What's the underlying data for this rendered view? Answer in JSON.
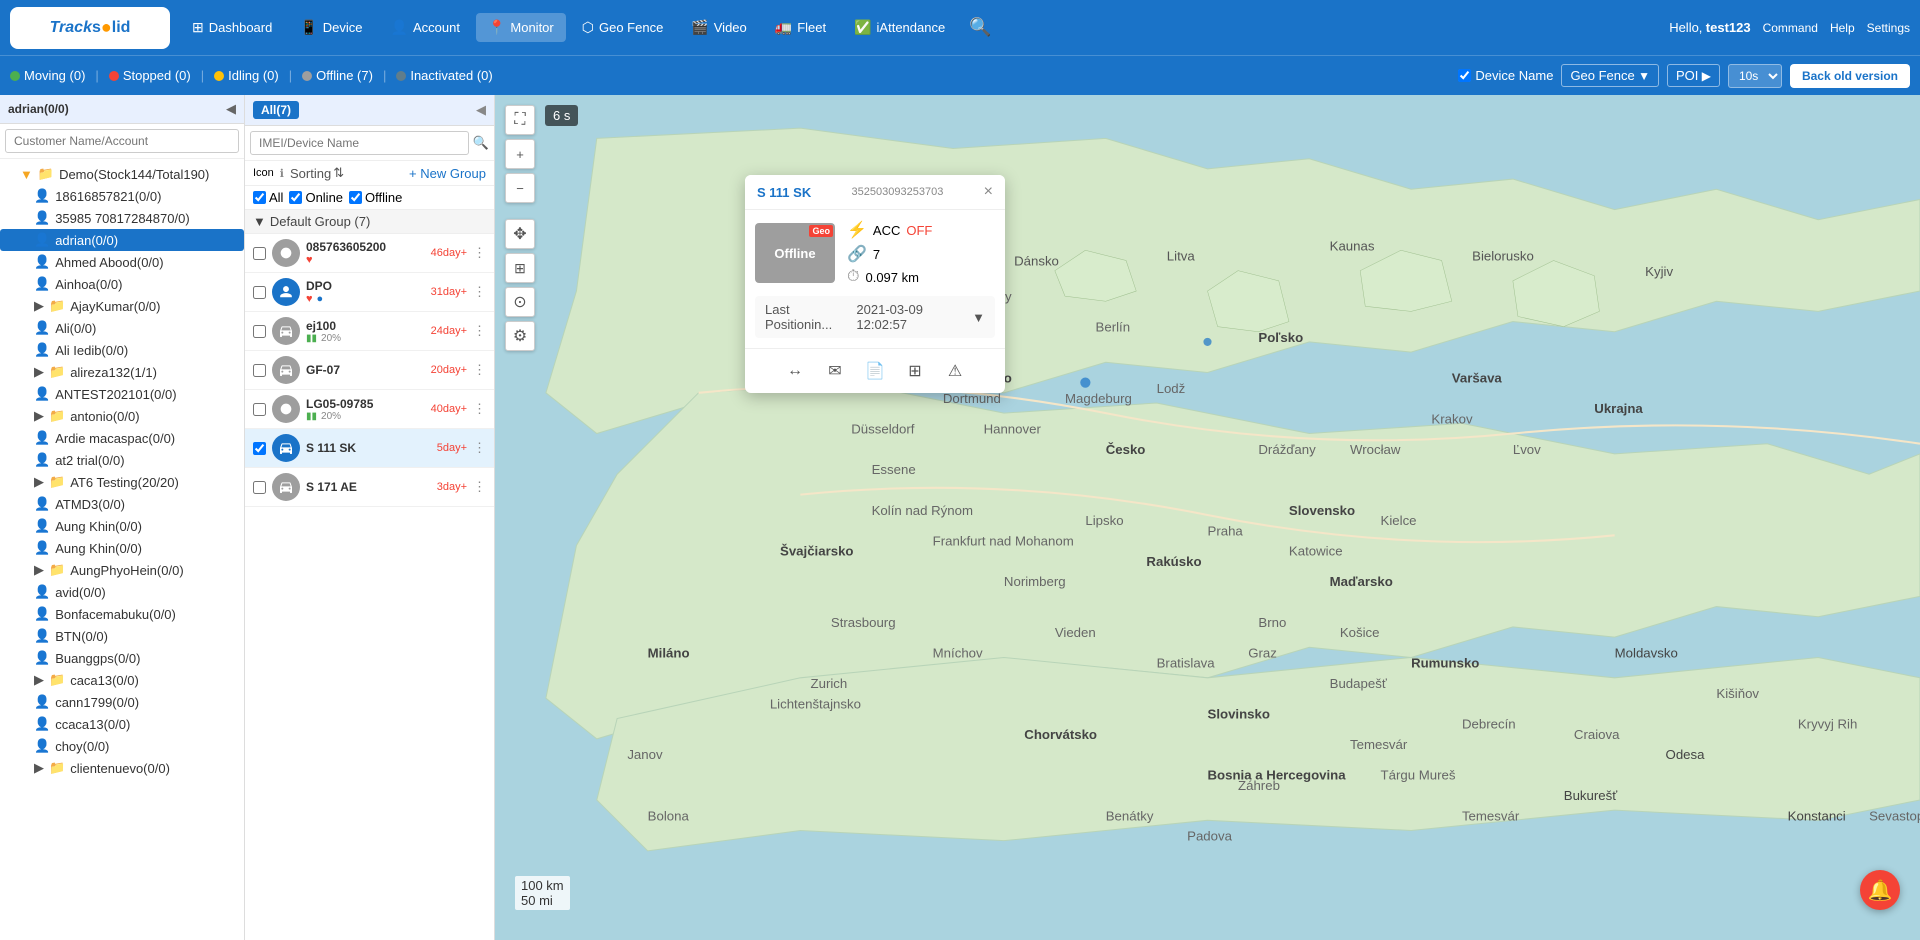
{
  "app": {
    "logo": "Track solid",
    "logo_dot": "·"
  },
  "nav": {
    "items": [
      {
        "id": "dashboard",
        "icon": "⊞",
        "label": "Dashboard"
      },
      {
        "id": "device",
        "icon": "📱",
        "label": "Device"
      },
      {
        "id": "account",
        "icon": "👤",
        "label": "Account"
      },
      {
        "id": "monitor",
        "icon": "📍",
        "label": "Monitor"
      },
      {
        "id": "geofence",
        "icon": "⬡",
        "label": "Geo Fence"
      },
      {
        "id": "video",
        "icon": "🎬",
        "label": "Video"
      },
      {
        "id": "fleet",
        "icon": "🚛",
        "label": "Fleet"
      },
      {
        "id": "iattendance",
        "icon": "✅",
        "label": "iAttendance"
      }
    ],
    "hello": "Hello,",
    "username": "test123",
    "command": "Command",
    "help": "Help",
    "settings": "Settings"
  },
  "statusbar": {
    "moving": "Moving (0)",
    "stopped": "Stopped (0)",
    "idling": "Idling (0)",
    "offline": "Offline (7)",
    "inactivated": "Inactivated (0)",
    "device_name_label": "Device Name",
    "geo_fence_label": "Geo Fence",
    "poi_label": "POI",
    "interval": "10s",
    "back_old_version": "Back old version"
  },
  "sidebar": {
    "header": "adrian(0/0)",
    "search_placeholder": "Customer Name/Account",
    "items": [
      {
        "id": "demo",
        "label": "Demo(Stock144/Total190)",
        "level": 1,
        "type": "group",
        "expanded": true
      },
      {
        "id": "acc1",
        "label": "18616857821(0/0)",
        "level": 2,
        "type": "person"
      },
      {
        "id": "acc2",
        "label": "35985 70817284870/0)",
        "level": 2,
        "type": "person"
      },
      {
        "id": "adrian",
        "label": "adrian(0/0)",
        "level": 2,
        "type": "person",
        "selected": true
      },
      {
        "id": "ahmed",
        "label": "Ahmed Abood(0/0)",
        "level": 2,
        "type": "person"
      },
      {
        "id": "ainhoa",
        "label": "Ainhoa(0/0)",
        "level": 2,
        "type": "person"
      },
      {
        "id": "ajay",
        "label": "AjayKumar(0/0)",
        "level": 2,
        "type": "group"
      },
      {
        "id": "ali",
        "label": "Ali(0/0)",
        "level": 2,
        "type": "person"
      },
      {
        "id": "ali_iedib",
        "label": "Ali Iedib(0/0)",
        "level": 2,
        "type": "person"
      },
      {
        "id": "alireza",
        "label": "alireza132(1/1)",
        "level": 2,
        "type": "group"
      },
      {
        "id": "antest",
        "label": "ANTEST202101(0/0)",
        "level": 2,
        "type": "person"
      },
      {
        "id": "antonio",
        "label": "antonio(0/0)",
        "level": 2,
        "type": "group"
      },
      {
        "id": "ardie",
        "label": "Ardie macaspac(0/0)",
        "level": 2,
        "type": "person"
      },
      {
        "id": "at2",
        "label": "at2 trial(0/0)",
        "level": 2,
        "type": "person"
      },
      {
        "id": "at6",
        "label": "AT6 Testing(20/20)",
        "level": 2,
        "type": "group"
      },
      {
        "id": "atmd3",
        "label": "ATMD3(0/0)",
        "level": 2,
        "type": "person"
      },
      {
        "id": "aung_khin1",
        "label": "Aung Khin(0/0)",
        "level": 2,
        "type": "person"
      },
      {
        "id": "aung_khin2",
        "label": "Aung Khin(0/0)",
        "level": 2,
        "type": "person"
      },
      {
        "id": "aungphyo",
        "label": "AungPhyoHein(0/0)",
        "level": 2,
        "type": "group"
      },
      {
        "id": "avid",
        "label": "avid(0/0)",
        "level": 2,
        "type": "person"
      },
      {
        "id": "bonfacemabuku",
        "label": "Bonfacemabuku(0/0)",
        "level": 2,
        "type": "person"
      },
      {
        "id": "btn",
        "label": "BTN(0/0)",
        "level": 2,
        "type": "person"
      },
      {
        "id": "buanggps",
        "label": "Buanggps(0/0)",
        "level": 2,
        "type": "person"
      },
      {
        "id": "caca13",
        "label": "caca13(0/0)",
        "level": 2,
        "type": "group"
      },
      {
        "id": "cann1799",
        "label": "cann1799(0/0)",
        "level": 2,
        "type": "person"
      },
      {
        "id": "ccaca13",
        "label": "ccaca13(0/0)",
        "level": 2,
        "type": "person"
      },
      {
        "id": "choy",
        "label": "choy(0/0)",
        "level": 2,
        "type": "person"
      },
      {
        "id": "clientenuevo",
        "label": "clientenuevo(0/0)",
        "level": 2,
        "type": "group"
      }
    ]
  },
  "device_list": {
    "header": "All(7)",
    "search_placeholder": "IMEI/Device Name",
    "sorting_label": "Sorting",
    "new_group_label": "+ New Group",
    "filter_all": "All",
    "filter_online": "Online",
    "filter_offline": "Offline",
    "group_name": "Default Group (7)",
    "devices": [
      {
        "id": "d1",
        "name": "085763605200",
        "days": "46day+",
        "type": "tracker",
        "has_heart": true,
        "battery": null
      },
      {
        "id": "d2",
        "name": "DPO",
        "days": "31day+",
        "type": "person",
        "has_heart": true,
        "has_blue": true,
        "battery": null
      },
      {
        "id": "d3",
        "name": "ej100",
        "days": "24day+",
        "type": "car",
        "battery": "20%",
        "has_heart": false
      },
      {
        "id": "d4",
        "name": "GF-07",
        "days": "20day+",
        "type": "car",
        "battery": null,
        "has_heart": false
      },
      {
        "id": "d5",
        "name": "LG05-09785",
        "days": "40day+",
        "type": "tracker",
        "battery": "20%",
        "has_heart": false
      },
      {
        "id": "d6",
        "name": "S 111 SK",
        "days": "5day+",
        "type": "car",
        "battery": null,
        "has_heart": false,
        "selected": true
      },
      {
        "id": "d7",
        "name": "S 171 AE",
        "days": "3day+",
        "type": "car",
        "battery": null,
        "has_heart": false
      }
    ]
  },
  "vehicle_popup": {
    "name": "S 111 SK",
    "imei": "352503093253703",
    "status": "Offline",
    "geo_badge": "Geo",
    "acc_label": "ACC",
    "acc_value": "OFF",
    "count_value": "7",
    "distance_value": "0.097 km",
    "location_label": "Last Positionin...",
    "location_time": "2021-03-09 12:02:57",
    "close": "×"
  },
  "map": {
    "zoom_in": "+",
    "zoom_out": "−",
    "timer": "6 s",
    "scale_km": "100 km",
    "scale_mi": "50 mi"
  }
}
